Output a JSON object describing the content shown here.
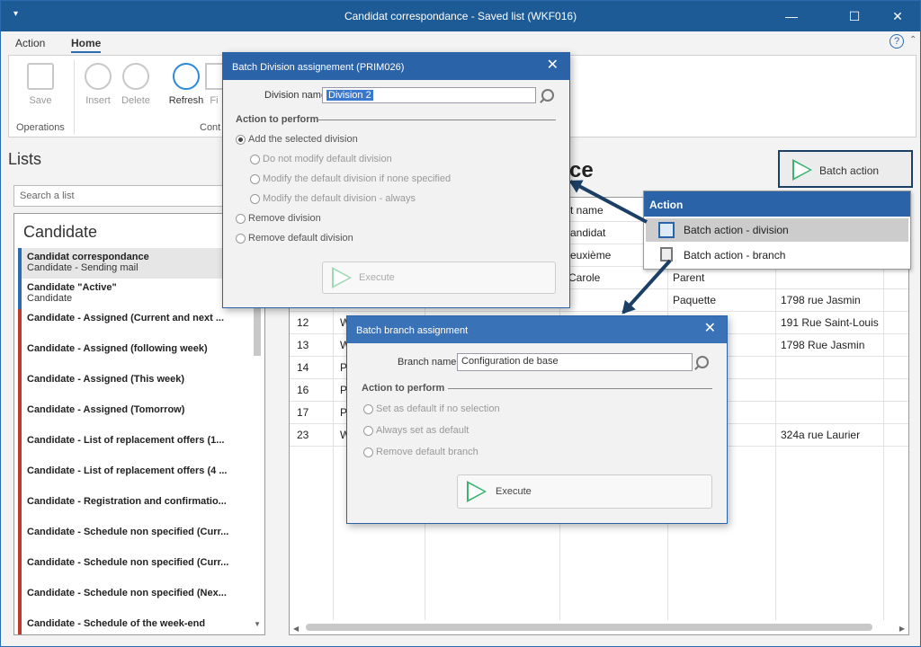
{
  "window": {
    "title": "Candidat correspondance - Saved list (WKF016)"
  },
  "menubar": {
    "items": [
      "Action",
      "Home"
    ]
  },
  "ribbon": {
    "save": "Save",
    "insert": "Insert",
    "delete": "Delete",
    "refresh": "Refresh",
    "filter_partial": "Fi",
    "group_operations": "Operations",
    "group_cont_partial": "Cont"
  },
  "lists": {
    "title": "Lists",
    "search_placeholder": "Search a list",
    "group": "Candidate",
    "items": [
      {
        "label": "Candidat correspondance",
        "sub": "Candidate - Sending mail"
      },
      {
        "label": "Candidate \"Active\"",
        "sub": "Candidate"
      },
      {
        "label": "Candidate - Assigned (Current and next ..."
      },
      {
        "label": "Candidate - Assigned (following week)"
      },
      {
        "label": "Candidate - Assigned (This week)"
      },
      {
        "label": "Candidate - Assigned (Tomorrow)"
      },
      {
        "label": "Candidate - List of replacement offers  (1..."
      },
      {
        "label": "Candidate - List of replacement offers (4 ..."
      },
      {
        "label": "Candidate - Registration and confirmatio..."
      },
      {
        "label": "Candidate - Schedule non specified (Curr..."
      },
      {
        "label": "Candidate - Schedule non specified (Curr..."
      },
      {
        "label": "Candidate - Schedule non specified (Nex..."
      },
      {
        "label": "Candidate - Schedule of the week-end"
      }
    ]
  },
  "main": {
    "title_partial": "ce",
    "batch_button": "Batch action",
    "grid": {
      "header_firstname": "rst name",
      "rows": [
        {
          "id": "",
          "a": "",
          "first": "andidat",
          "last": "",
          "addr": ""
        },
        {
          "id": "",
          "a": "",
          "first": "euxième",
          "last": "",
          "addr": ""
        },
        {
          "id": "",
          "a": "",
          "first": "Carole",
          "last": "Parent",
          "addr": ""
        },
        {
          "id": "",
          "a": "",
          "first": "",
          "last": "Paquette",
          "addr": "1798 rue Jasmin"
        },
        {
          "id": "12",
          "a": "W",
          "first": "",
          "last": "",
          "addr": "191 Rue Saint-Louis"
        },
        {
          "id": "13",
          "a": "W",
          "first": "",
          "last": "",
          "addr": "1798 Rue Jasmin"
        },
        {
          "id": "14",
          "a": "P",
          "first": "",
          "last": "",
          "addr": ""
        },
        {
          "id": "16",
          "a": "P",
          "first": "",
          "last": "",
          "addr": ""
        },
        {
          "id": "17",
          "a": "P",
          "first": "",
          "last": "",
          "addr": ""
        },
        {
          "id": "23",
          "a": "W",
          "first": "",
          "last": "",
          "addr": "324a rue Laurier"
        }
      ]
    }
  },
  "action_menu": {
    "header": "Action",
    "items": [
      "Batch action - division",
      "Batch action - branch"
    ]
  },
  "division_dialog": {
    "title": "Batch Division assignement (PRIM026)",
    "field_label": "Division name",
    "field_value": "Division 2",
    "section": "Action to perform",
    "options": [
      "Add the selected division",
      "Do not modify default division",
      "Modify the default division if none specified",
      "Modify the default division - always",
      "Remove division",
      "Remove default division"
    ],
    "execute": "Execute"
  },
  "branch_dialog": {
    "title": "Batch branch assignment",
    "field_label": "Branch name",
    "field_value": "Configuration de base",
    "section": "Action to perform",
    "options": [
      "Set as default if no selection",
      "Always set as default",
      "Remove default branch"
    ],
    "execute": "Execute"
  },
  "colors": {
    "titlebar": "#1d5b96",
    "accent": "#2a63a8",
    "execute_green": "#3cb371",
    "arrow": "#1c3f66"
  }
}
